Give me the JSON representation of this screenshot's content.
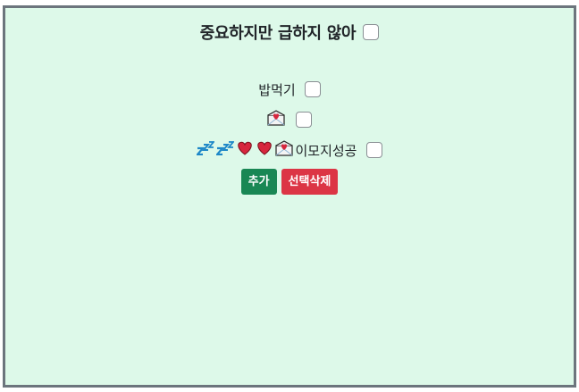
{
  "header": {
    "title": "중요하지만 급하지 않아"
  },
  "todos": [
    {
      "text": "밥먹기",
      "emojis": [],
      "checked": false
    },
    {
      "text": "",
      "emojis": [
        "envelope-heart-icon"
      ],
      "checked": false
    },
    {
      "text": "이모지성공",
      "emojis": [
        "zzz-icon",
        "zzz-icon",
        "heart-icon",
        "heart-icon",
        "envelope-heart-icon"
      ],
      "checked": false
    }
  ],
  "buttons": {
    "add_label": "추가",
    "delete_selected_label": "선택삭제"
  },
  "colors": {
    "background": "#ddf9e9",
    "border": "#6c757d",
    "add_button": "#198754",
    "delete_button": "#dc3545"
  }
}
